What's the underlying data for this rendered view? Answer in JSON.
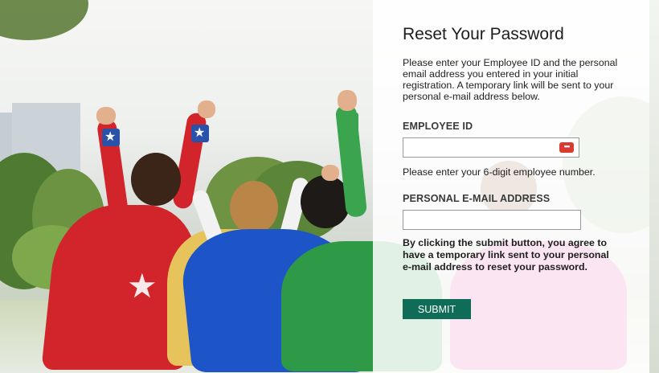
{
  "form": {
    "title": "Reset Your Password",
    "intro": "Please enter your Employee ID and the personal email address you entered in your initial registration. A temporary link will be sent to your personal e-mail address below.",
    "employee_id": {
      "label": "EMPLOYEE ID",
      "value": "",
      "hint": "Please enter your 6-digit employee number."
    },
    "email": {
      "label": "PERSONAL E-MAIL ADDRESS",
      "value": ""
    },
    "agreement": "By clicking the submit button, you agree to have a temporary link sent to your personal e-mail address to reset your password.",
    "submit_label": "SUBMIT"
  },
  "colors": {
    "submit_button": "#0f6d57",
    "password_manager_icon": "#d93b30",
    "panel_background": "rgba(255,255,255,0.86)"
  },
  "icons": {
    "employee_field_icon": "password-manager-icon"
  }
}
